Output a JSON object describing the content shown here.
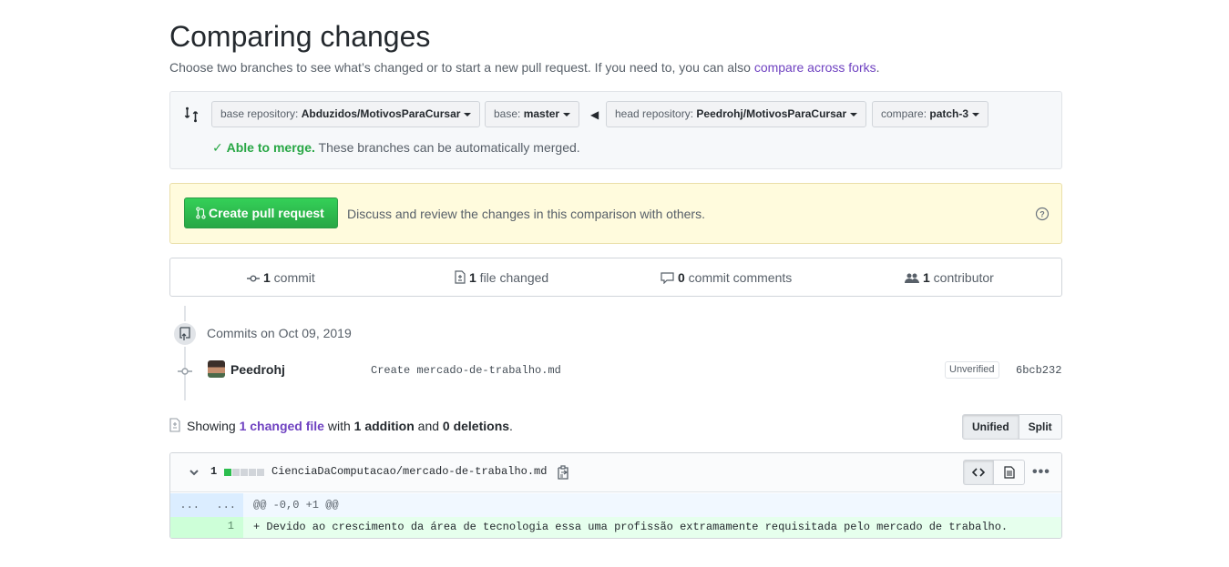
{
  "header": {
    "title": "Comparing changes",
    "subtitle": "Choose two branches to see what’s changed or to start a new pull request. If you need to, you can also ",
    "subtitle_link": "compare across forks",
    "subtitle_end": "."
  },
  "range": {
    "base_repo_label": "base repository: ",
    "base_repo_value": "Abduzidos/MotivosParaCursar",
    "base_label": "base: ",
    "base_value": "master",
    "head_repo_label": "head repository: ",
    "head_repo_value": "Peedrohj/MotivosParaCursar",
    "compare_label": "compare: ",
    "compare_value": "patch-3",
    "merge_check": "✓",
    "merge_status": "Able to merge.",
    "merge_text": " These branches can be automatically merged."
  },
  "pr": {
    "button_label": "Create pull request",
    "description": "Discuss and review the changes in this comparison with others."
  },
  "numbers": [
    {
      "count": "1",
      "label": " commit"
    },
    {
      "count": "1",
      "label": " file changed"
    },
    {
      "count": "0",
      "label": " commit comments"
    },
    {
      "count": "1",
      "label": " contributor"
    }
  ],
  "commits": {
    "date_heading": "Commits on Oct 09, 2019",
    "items": [
      {
        "author": "Peedrohj",
        "message": "Create mercado-de-trabalho.md",
        "badge": "Unverified",
        "sha": "6bcb232"
      }
    ]
  },
  "toc": {
    "showing": "Showing ",
    "changed_link": "1 changed file",
    "with": " with ",
    "additions": "1 addition",
    "and": " and ",
    "deletions": "0 deletions",
    "end": ".",
    "unified_label": "Unified",
    "split_label": "Split",
    "selected_view": "Unified"
  },
  "file": {
    "change_count": "1",
    "path": "CienciaDaComputacao/mercado-de-trabalho.md",
    "diffstat_colors": [
      "#2cbe4e",
      "#d1d5da",
      "#d1d5da",
      "#d1d5da",
      "#d1d5da"
    ],
    "hunk_left": "...",
    "hunk_right": "...",
    "hunk_header": "@@ -0,0 +1 @@",
    "lines": [
      {
        "old": "",
        "new": "1",
        "text": "+ Devido ao crescimento da área de tecnologia essa uma profissão extramamente requisitada pelo mercado de trabalho."
      }
    ]
  },
  "colors": {
    "accent_link": "#6f42c1",
    "success": "#28a745",
    "addition_bg": "#e6ffed",
    "hunk_bg": "#f1f8ff"
  }
}
